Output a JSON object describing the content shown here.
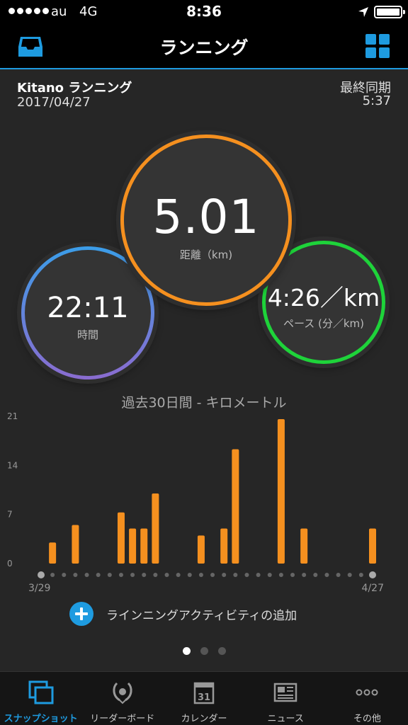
{
  "status": {
    "carrier": "au",
    "network": "4G",
    "time": "8:36"
  },
  "nav": {
    "title": "ランニング",
    "inbox_icon": "inbox-icon",
    "grid_icon": "grid-icon"
  },
  "header": {
    "activity_name": "Kitano ランニング",
    "date": "2017/04/27",
    "sync_label": "最終同期",
    "sync_time": "5:37"
  },
  "stats": {
    "distance": {
      "value": "5.01",
      "label": "距離（km)"
    },
    "time": {
      "value": "22:11",
      "label": "時間"
    },
    "pace": {
      "value": "4:26／km",
      "label": "ペース (分／km)"
    }
  },
  "colors": {
    "accent": "#1e9be0",
    "distance_ring": "#f5901f",
    "pace_ring": "#1ed33a",
    "bar": "#f5901f"
  },
  "chart_data": {
    "type": "bar",
    "title": "過去30日間 - キロメートル",
    "x_start_label": "3/29",
    "x_end_label": "4/27",
    "y_ticks": [
      "21",
      "14",
      "7",
      "0"
    ],
    "ylim": [
      0,
      21
    ],
    "values": [
      0,
      3.0,
      0,
      5.5,
      0,
      0,
      0,
      7.3,
      5.0,
      5.0,
      10.0,
      0,
      0,
      0,
      4.0,
      0,
      5.0,
      16.3,
      0,
      0,
      0,
      20.6,
      0,
      5.0,
      0,
      0,
      0,
      0,
      0,
      5.0
    ]
  },
  "add_activity": {
    "label": "ラインニングアクティビティの追加"
  },
  "tabs": [
    {
      "label": "スナップショット",
      "icon": "snapshot-icon",
      "active": true
    },
    {
      "label": "リーダーボード",
      "icon": "laurel-icon",
      "active": false
    },
    {
      "label": "カレンダー",
      "icon": "calendar-icon",
      "active": false,
      "badge": "31"
    },
    {
      "label": "ニュース",
      "icon": "newspaper-icon",
      "active": false
    },
    {
      "label": "その他",
      "icon": "more-icon",
      "active": false
    }
  ]
}
